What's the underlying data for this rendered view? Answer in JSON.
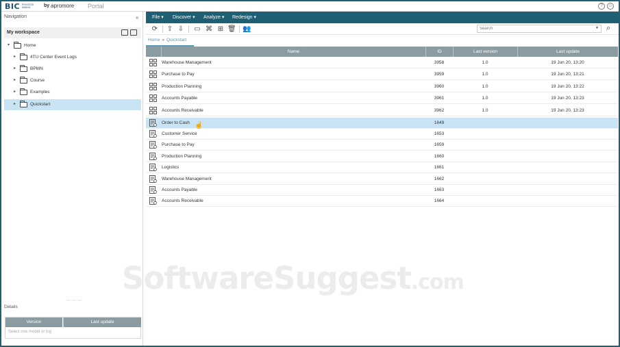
{
  "header": {
    "logo_bic": "BIC",
    "logo_sub": "PROCESS MINING",
    "logo_by": "by",
    "logo_apromore": "apromore",
    "portal": "Portal",
    "help_icon": "?",
    "user_icon": "☺"
  },
  "navigation": {
    "title": "Navigation",
    "collapse_icon": "«",
    "workspace_label": "My workspace",
    "home_label": "Home",
    "folders": [
      {
        "label": "4TU Center Event Logs"
      },
      {
        "label": "BPMN"
      },
      {
        "label": "Course"
      },
      {
        "label": "Examples"
      },
      {
        "label": "Quickstart"
      }
    ]
  },
  "details": {
    "title": "Details",
    "col_version": "Version",
    "col_last_update": "Last update",
    "empty_text": "Select one model or log"
  },
  "menu": {
    "items": [
      "File",
      "Discover",
      "Analyze",
      "Redesign"
    ]
  },
  "toolbar": {
    "search_placeholder": "Search"
  },
  "breadcrumb": {
    "home": "Home",
    "separator": "»",
    "current": "Quickstart"
  },
  "grid": {
    "columns": {
      "name": "Name",
      "id": "ID",
      "last_version": "Last version",
      "last_update": "Last update"
    },
    "rows": [
      {
        "type": "model",
        "name": "Warehouse Management",
        "id": "3958",
        "version": "1.0",
        "update": "19 Jun 20, 13:20"
      },
      {
        "type": "model",
        "name": "Purchase to Pay",
        "id": "3959",
        "version": "1.0",
        "update": "19 Jun 20, 13:21"
      },
      {
        "type": "model",
        "name": "Production Planning",
        "id": "3960",
        "version": "1.0",
        "update": "19 Jun 20, 13:22"
      },
      {
        "type": "model",
        "name": "Accounts Payable",
        "id": "3961",
        "version": "1.0",
        "update": "19 Jun 20, 13:23"
      },
      {
        "type": "model",
        "name": "Accounts Receivable",
        "id": "3962",
        "version": "1.0",
        "update": "19 Jun 20, 13:23"
      },
      {
        "type": "log",
        "name": "Order to Cash",
        "id": "1649",
        "version": "",
        "update": ""
      },
      {
        "type": "log",
        "name": "Customer Service",
        "id": "1653",
        "version": "",
        "update": ""
      },
      {
        "type": "log",
        "name": "Purchase to Pay",
        "id": "1659",
        "version": "",
        "update": ""
      },
      {
        "type": "log",
        "name": "Production Planning",
        "id": "1660",
        "version": "",
        "update": ""
      },
      {
        "type": "log",
        "name": "Logistics",
        "id": "1661",
        "version": "",
        "update": ""
      },
      {
        "type": "log",
        "name": "Warehouse Management",
        "id": "1662",
        "version": "",
        "update": ""
      },
      {
        "type": "log",
        "name": "Accounts Payable",
        "id": "1663",
        "version": "",
        "update": ""
      },
      {
        "type": "log",
        "name": "Accounts Receivable",
        "id": "1664",
        "version": "",
        "update": ""
      }
    ]
  },
  "watermark": {
    "main": "SoftwareSuggest",
    "suffix": ".com"
  },
  "colors": {
    "accent": "#1f5f73",
    "header_grey": "#8a9ba1",
    "selection": "#c8e3f3",
    "link": "#5b9bb5"
  }
}
